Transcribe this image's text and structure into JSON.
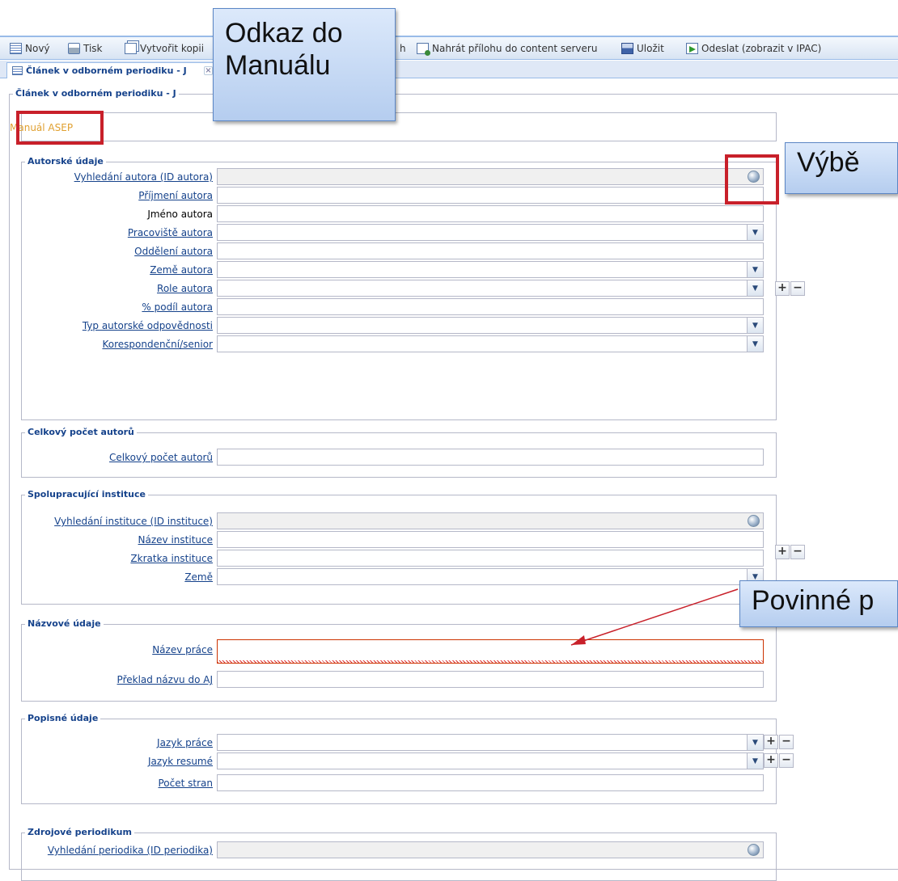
{
  "toolbar": {
    "new_label": "Nový",
    "print_label": "Tisk",
    "copy_label": "Vytvořit kopii",
    "hidden_fragment": "h",
    "upload_label": "Nahrát přílohu do content serveru",
    "save_label": "Uložit",
    "send_label": "Odeslat (zobrazit v IPAC)"
  },
  "tab": {
    "title": "Článek v odborném periodiku - J",
    "close": "×"
  },
  "form": {
    "legend": "Článek v odborném periodiku - J",
    "manual_link": "Manuál ASEP",
    "sections": {
      "authors": {
        "legend": "Autorské údaje",
        "fields": [
          "Vyhledání autora (ID autora)",
          "Příjmení autora",
          "Jméno autora",
          "Pracoviště autora",
          "Oddělení autora",
          "Země autora",
          "Role autora",
          "% podíl autora",
          "Typ autorské odpovědnosti",
          "Korespondenční/senior"
        ]
      },
      "total": {
        "legend": "Celkový počet autorů",
        "fields": [
          "Celkový počet autorů"
        ]
      },
      "institutions": {
        "legend": "Spolupracující instituce",
        "fields": [
          "Vyhledání instituce (ID instituce)",
          "Název instituce",
          "Zkratka instituce",
          "Země"
        ]
      },
      "title": {
        "legend": "Názvové údaje",
        "fields": [
          "Název práce",
          "Překlad názvu do AJ"
        ]
      },
      "descriptive": {
        "legend": "Popisné údaje",
        "fields": [
          "Jazyk práce",
          "Jazyk resumé",
          "Počet stran"
        ]
      },
      "source": {
        "legend": "Zdrojové periodikum",
        "fields": [
          "Vyhledání periodika (ID periodika)"
        ]
      }
    },
    "plus": "+",
    "minus": "−",
    "dropdown_arrow": "▼"
  },
  "annotations": {
    "manual": "Odkaz do\nManuálu",
    "select": "Výbě",
    "required": "Povinné p"
  },
  "colors": {
    "accent": "#15428b",
    "annotation_red": "#c8202a",
    "manual_link": "#e0a030"
  },
  "icons": [
    "new-icon",
    "print-icon",
    "copy-icon",
    "upload-icon",
    "save-icon",
    "send-icon",
    "globe-icon",
    "chevron-down-icon"
  ]
}
